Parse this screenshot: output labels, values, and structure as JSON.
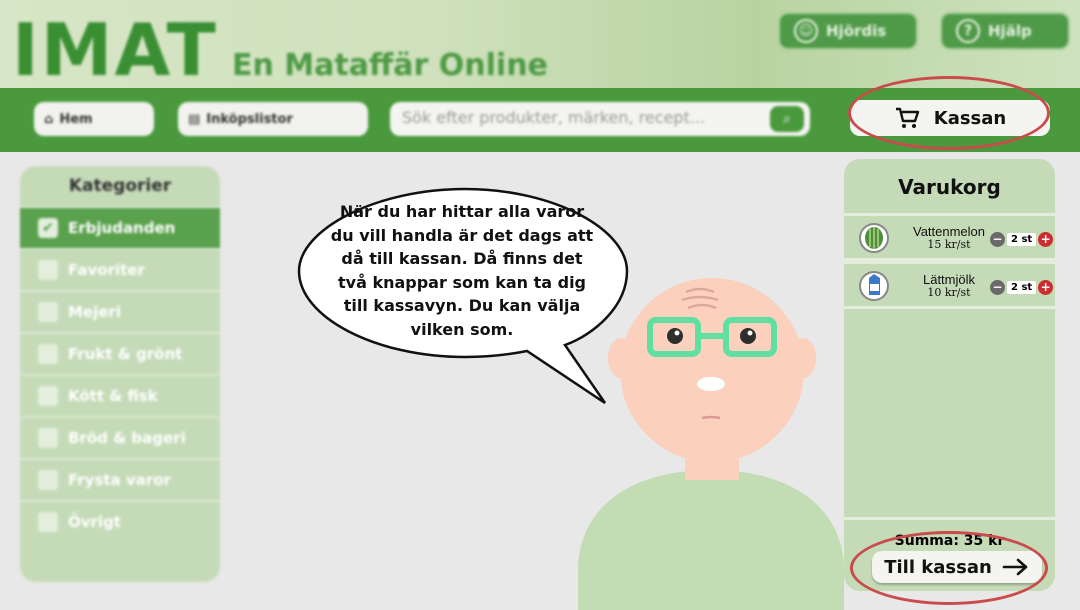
{
  "header": {
    "logo": "IMAT",
    "tagline": "En Mataffär Online",
    "user_button": "Hjördis",
    "help_button": "Hjälp"
  },
  "nav": {
    "home": "Hem",
    "lists": "Inköpslistor",
    "search_placeholder": "Sök efter produkter, märken, recept...",
    "checkout": "Kassan"
  },
  "sidebar": {
    "title": "Kategorier",
    "items": [
      {
        "label": "Erbjudanden",
        "checked": true
      },
      {
        "label": "Favoriter",
        "checked": false
      },
      {
        "label": "Mejeri",
        "checked": false
      },
      {
        "label": "Frukt & grönt",
        "checked": false
      },
      {
        "label": "Kött & fisk",
        "checked": false
      },
      {
        "label": "Bröd & bageri",
        "checked": false
      },
      {
        "label": "Frysta varor",
        "checked": false
      },
      {
        "label": "Övrigt",
        "checked": false
      }
    ]
  },
  "cart": {
    "title": "Varukorg",
    "items": [
      {
        "name": "Vattenmelon",
        "price": "15 kr/st",
        "qty": "2 st"
      },
      {
        "name": "Lättmjölk",
        "price": "10 kr/st",
        "qty": "2 st"
      }
    ],
    "summa": "Summa: 35 kr",
    "checkout_button": "Till kassan"
  },
  "speech": {
    "lines": [
      "När du har hittar alla varor",
      "du vill handla är det dags att",
      "då till kassan. Då finns det",
      "två knappar som kan ta dig",
      "till kassavyn. Du kan välja",
      "vilken som."
    ]
  },
  "colors": {
    "brand_green": "#4a9a3d",
    "panel_green": "#c5dbb8",
    "highlight_ring": "#c94b4b",
    "plus_red": "#cc2e2e"
  }
}
